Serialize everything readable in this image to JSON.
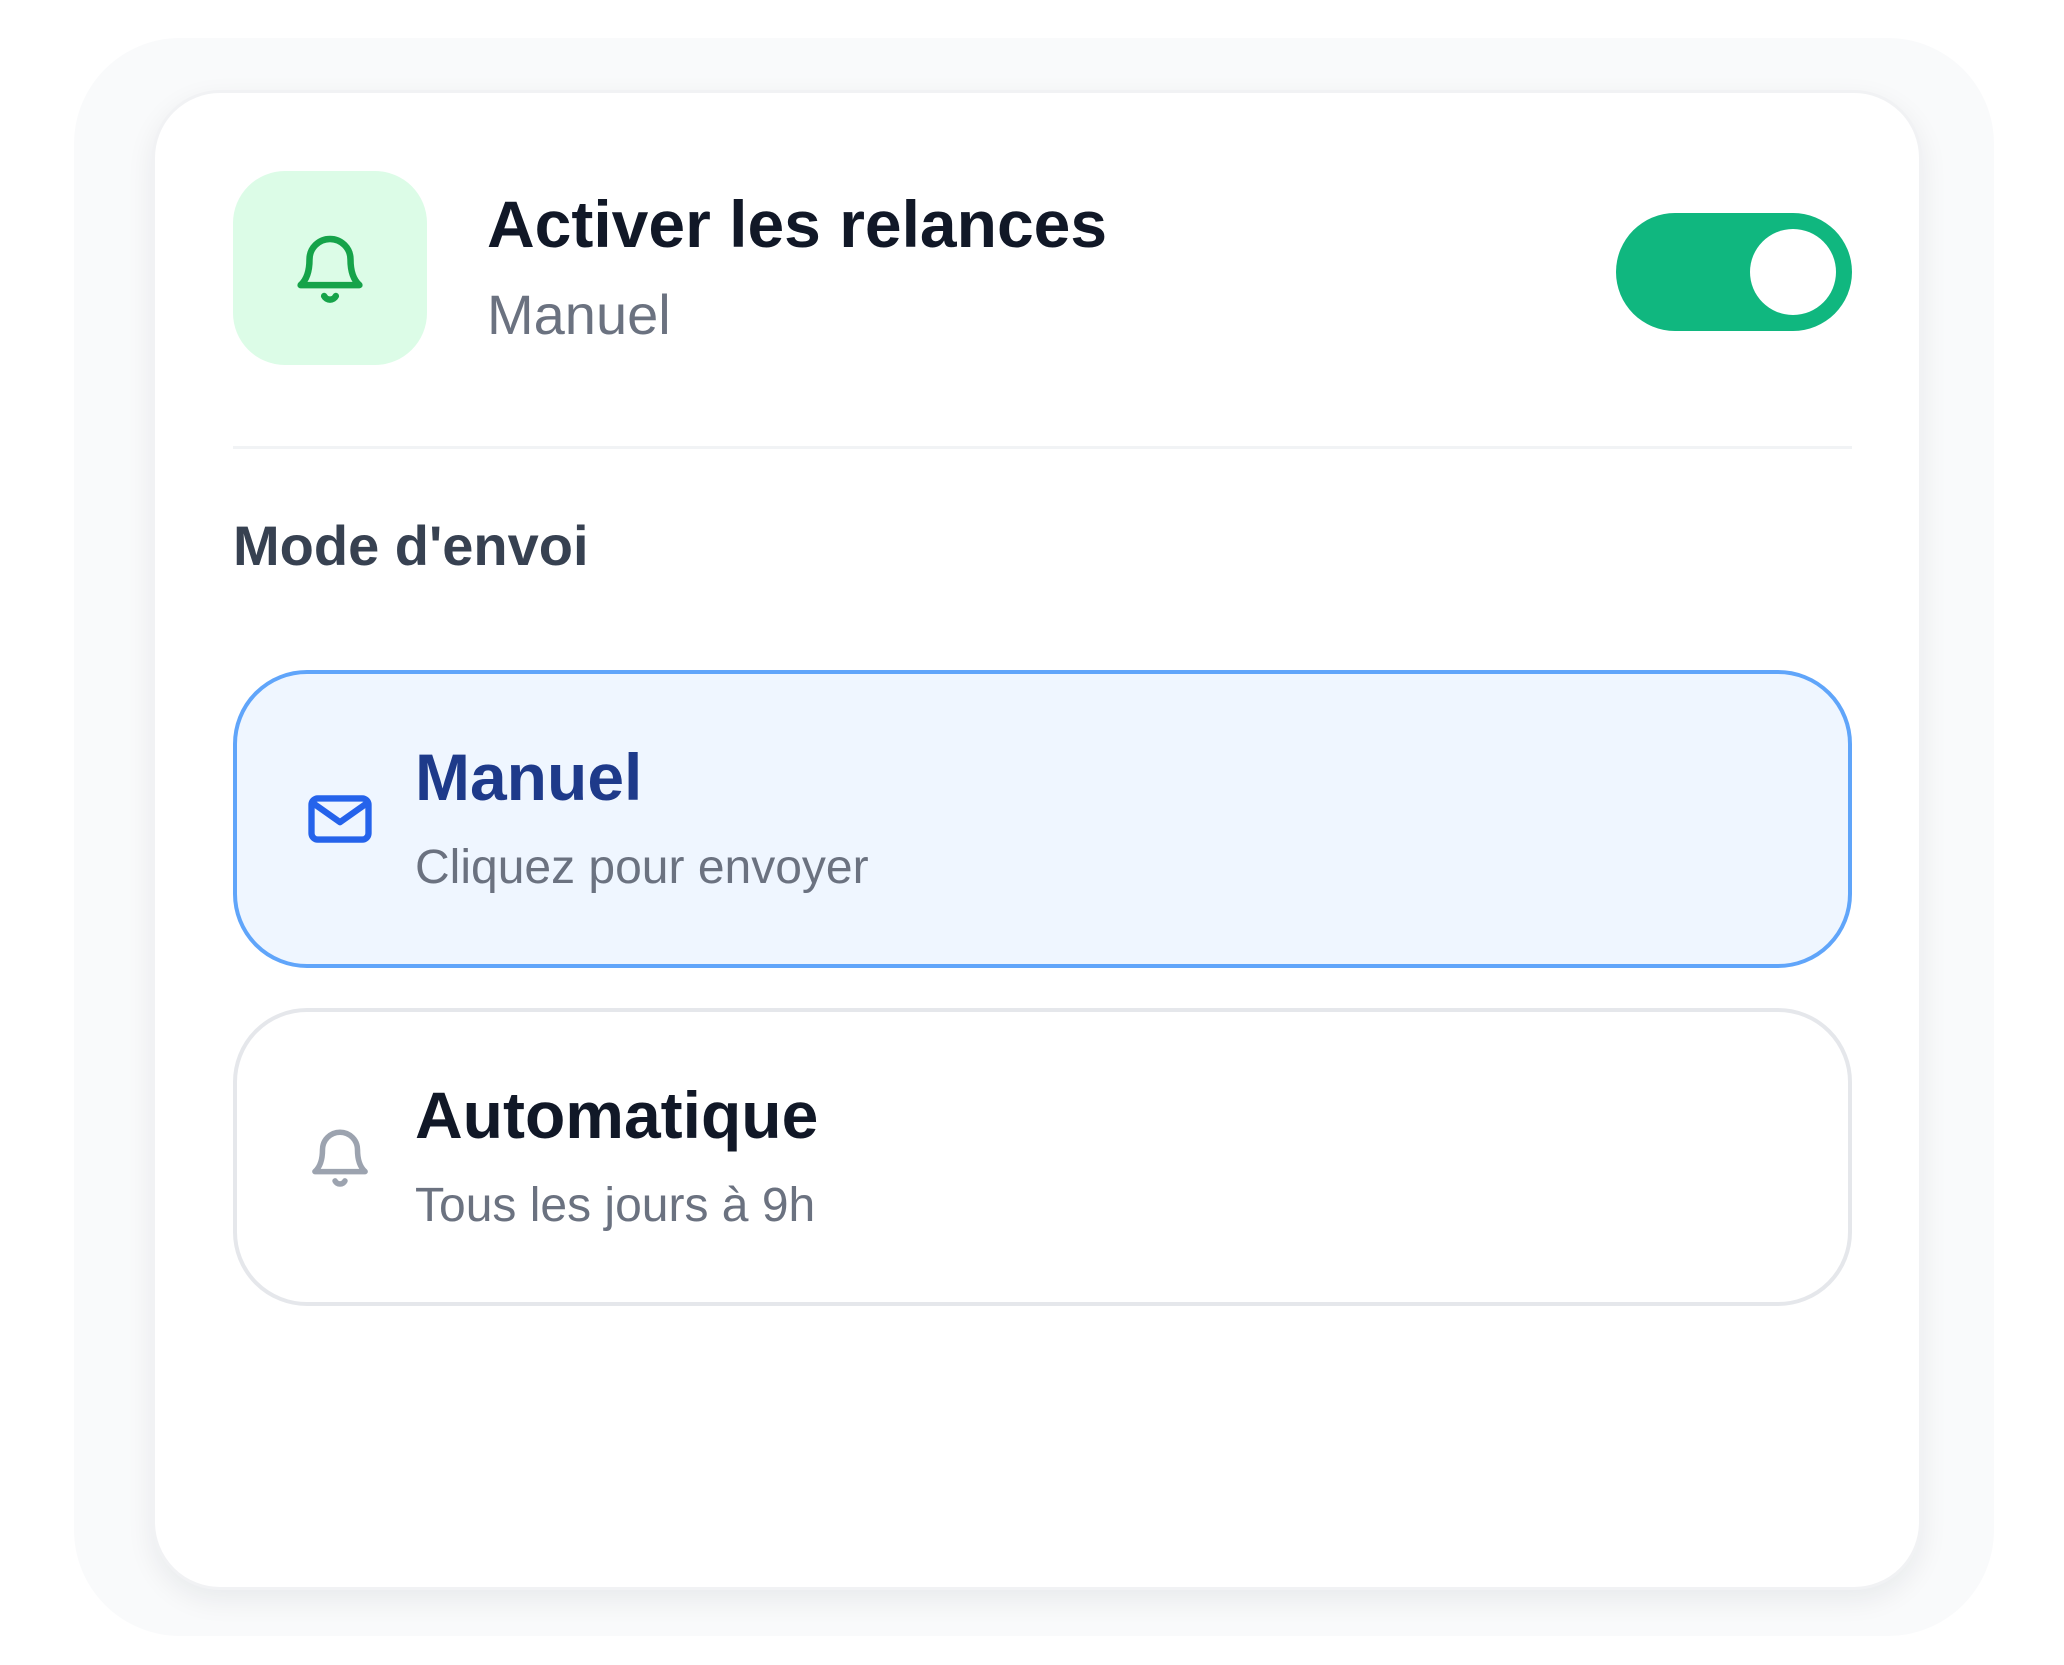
{
  "header": {
    "title": "Activer les relances",
    "subtitle": "Manuel",
    "icon": "bell-icon",
    "toggle_on": true
  },
  "section": {
    "label": "Mode d'envoi"
  },
  "options": [
    {
      "title": "Manuel",
      "description": "Cliquez pour envoyer",
      "icon": "mail-icon",
      "selected": true
    },
    {
      "title": "Automatique",
      "description": "Tous les jours à 9h",
      "icon": "bell-icon",
      "selected": false
    }
  ],
  "colors": {
    "toggle_on": "#10b77f",
    "header_icon_bg": "#dcfce7",
    "header_icon": "#16a34a",
    "selected_border": "#60a5fa",
    "selected_bg": "#eff6ff",
    "selected_icon": "#2563eb",
    "unselected_icon": "#9ca3af"
  }
}
